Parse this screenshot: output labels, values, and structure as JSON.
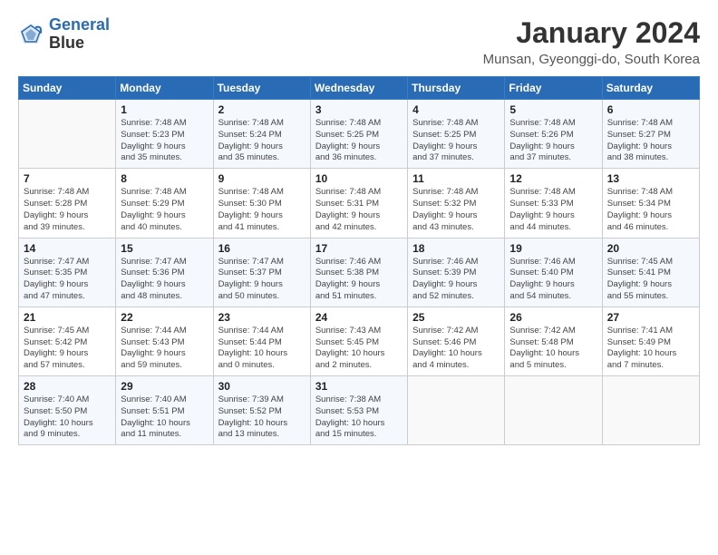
{
  "header": {
    "logo_line1": "General",
    "logo_line2": "Blue",
    "month_title": "January 2024",
    "location": "Munsan, Gyeonggi-do, South Korea"
  },
  "days_of_week": [
    "Sunday",
    "Monday",
    "Tuesday",
    "Wednesday",
    "Thursday",
    "Friday",
    "Saturday"
  ],
  "weeks": [
    [
      {
        "day": "",
        "details": ""
      },
      {
        "day": "1",
        "details": "Sunrise: 7:48 AM\nSunset: 5:23 PM\nDaylight: 9 hours\nand 35 minutes."
      },
      {
        "day": "2",
        "details": "Sunrise: 7:48 AM\nSunset: 5:24 PM\nDaylight: 9 hours\nand 35 minutes."
      },
      {
        "day": "3",
        "details": "Sunrise: 7:48 AM\nSunset: 5:25 PM\nDaylight: 9 hours\nand 36 minutes."
      },
      {
        "day": "4",
        "details": "Sunrise: 7:48 AM\nSunset: 5:25 PM\nDaylight: 9 hours\nand 37 minutes."
      },
      {
        "day": "5",
        "details": "Sunrise: 7:48 AM\nSunset: 5:26 PM\nDaylight: 9 hours\nand 37 minutes."
      },
      {
        "day": "6",
        "details": "Sunrise: 7:48 AM\nSunset: 5:27 PM\nDaylight: 9 hours\nand 38 minutes."
      }
    ],
    [
      {
        "day": "7",
        "details": "Sunrise: 7:48 AM\nSunset: 5:28 PM\nDaylight: 9 hours\nand 39 minutes."
      },
      {
        "day": "8",
        "details": "Sunrise: 7:48 AM\nSunset: 5:29 PM\nDaylight: 9 hours\nand 40 minutes."
      },
      {
        "day": "9",
        "details": "Sunrise: 7:48 AM\nSunset: 5:30 PM\nDaylight: 9 hours\nand 41 minutes."
      },
      {
        "day": "10",
        "details": "Sunrise: 7:48 AM\nSunset: 5:31 PM\nDaylight: 9 hours\nand 42 minutes."
      },
      {
        "day": "11",
        "details": "Sunrise: 7:48 AM\nSunset: 5:32 PM\nDaylight: 9 hours\nand 43 minutes."
      },
      {
        "day": "12",
        "details": "Sunrise: 7:48 AM\nSunset: 5:33 PM\nDaylight: 9 hours\nand 44 minutes."
      },
      {
        "day": "13",
        "details": "Sunrise: 7:48 AM\nSunset: 5:34 PM\nDaylight: 9 hours\nand 46 minutes."
      }
    ],
    [
      {
        "day": "14",
        "details": "Sunrise: 7:47 AM\nSunset: 5:35 PM\nDaylight: 9 hours\nand 47 minutes."
      },
      {
        "day": "15",
        "details": "Sunrise: 7:47 AM\nSunset: 5:36 PM\nDaylight: 9 hours\nand 48 minutes."
      },
      {
        "day": "16",
        "details": "Sunrise: 7:47 AM\nSunset: 5:37 PM\nDaylight: 9 hours\nand 50 minutes."
      },
      {
        "day": "17",
        "details": "Sunrise: 7:46 AM\nSunset: 5:38 PM\nDaylight: 9 hours\nand 51 minutes."
      },
      {
        "day": "18",
        "details": "Sunrise: 7:46 AM\nSunset: 5:39 PM\nDaylight: 9 hours\nand 52 minutes."
      },
      {
        "day": "19",
        "details": "Sunrise: 7:46 AM\nSunset: 5:40 PM\nDaylight: 9 hours\nand 54 minutes."
      },
      {
        "day": "20",
        "details": "Sunrise: 7:45 AM\nSunset: 5:41 PM\nDaylight: 9 hours\nand 55 minutes."
      }
    ],
    [
      {
        "day": "21",
        "details": "Sunrise: 7:45 AM\nSunset: 5:42 PM\nDaylight: 9 hours\nand 57 minutes."
      },
      {
        "day": "22",
        "details": "Sunrise: 7:44 AM\nSunset: 5:43 PM\nDaylight: 9 hours\nand 59 minutes."
      },
      {
        "day": "23",
        "details": "Sunrise: 7:44 AM\nSunset: 5:44 PM\nDaylight: 10 hours\nand 0 minutes."
      },
      {
        "day": "24",
        "details": "Sunrise: 7:43 AM\nSunset: 5:45 PM\nDaylight: 10 hours\nand 2 minutes."
      },
      {
        "day": "25",
        "details": "Sunrise: 7:42 AM\nSunset: 5:46 PM\nDaylight: 10 hours\nand 4 minutes."
      },
      {
        "day": "26",
        "details": "Sunrise: 7:42 AM\nSunset: 5:48 PM\nDaylight: 10 hours\nand 5 minutes."
      },
      {
        "day": "27",
        "details": "Sunrise: 7:41 AM\nSunset: 5:49 PM\nDaylight: 10 hours\nand 7 minutes."
      }
    ],
    [
      {
        "day": "28",
        "details": "Sunrise: 7:40 AM\nSunset: 5:50 PM\nDaylight: 10 hours\nand 9 minutes."
      },
      {
        "day": "29",
        "details": "Sunrise: 7:40 AM\nSunset: 5:51 PM\nDaylight: 10 hours\nand 11 minutes."
      },
      {
        "day": "30",
        "details": "Sunrise: 7:39 AM\nSunset: 5:52 PM\nDaylight: 10 hours\nand 13 minutes."
      },
      {
        "day": "31",
        "details": "Sunrise: 7:38 AM\nSunset: 5:53 PM\nDaylight: 10 hours\nand 15 minutes."
      },
      {
        "day": "",
        "details": ""
      },
      {
        "day": "",
        "details": ""
      },
      {
        "day": "",
        "details": ""
      }
    ]
  ]
}
